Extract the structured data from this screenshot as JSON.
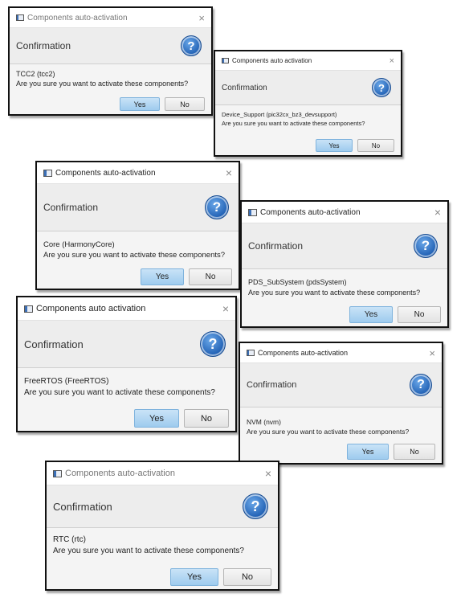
{
  "common": {
    "confirmation": "Confirmation",
    "question_mark": "?",
    "question": "Are you sure you want to activate these components?",
    "yes": "Yes",
    "no": "No",
    "close": "×"
  },
  "dialogs": [
    {
      "title": "Components auto-activation",
      "component": "TCC2 (tcc2)"
    },
    {
      "title": "Components auto activation",
      "component": "Device_Support (pic32cx_bz3_devsupport)"
    },
    {
      "title": "Components auto-activation",
      "component": "Core (HarmonyCore)"
    },
    {
      "title": "Components auto-activation",
      "component": "PDS_SubSystem (pdsSystem)"
    },
    {
      "title": "Components auto activation",
      "component": "FreeRTOS (FreeRTOS)"
    },
    {
      "title": "Components auto-activation",
      "component": "NVM (nvm)"
    },
    {
      "title": "Components auto-activation",
      "component": "RTC (rtc)"
    }
  ],
  "colors": {
    "accent": "#1f5fb3",
    "yes_button": "#9ecbee",
    "header_bg": "#ededed"
  }
}
